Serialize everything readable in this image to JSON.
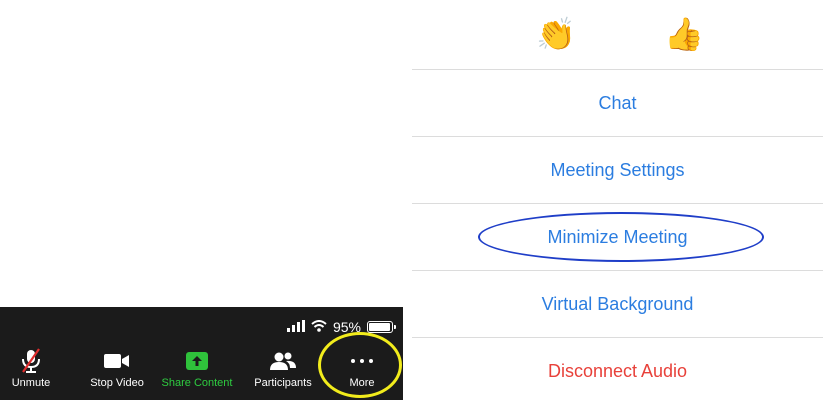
{
  "status_bar": {
    "battery_percent": "95%",
    "battery_level": 0.95
  },
  "toolbar": {
    "unmute_label": "Unmute",
    "stop_video_label": "Stop Video",
    "share_label": "Share Content",
    "participants_label": "Participants",
    "more_label": "More"
  },
  "menu": {
    "items": [
      {
        "label": "Chat"
      },
      {
        "label": "Meeting Settings"
      },
      {
        "label": "Minimize Meeting"
      },
      {
        "label": "Virtual Background"
      },
      {
        "label": "Disconnect Audio"
      }
    ]
  },
  "colors": {
    "toolbar_bg": "#1b1b1b",
    "share_green": "#2fc23b",
    "menu_blue": "#2b7de0",
    "danger_red": "#e8413a",
    "annotation_yellow": "#f2ec1c",
    "annotation_blue": "#1f3ec8"
  },
  "icons": [
    "clapping-hands-icon",
    "thumbs-up-icon",
    "microphone-muted-icon",
    "video-camera-icon",
    "share-arrow-icon",
    "participants-icon",
    "more-dots-icon",
    "signal-icon",
    "wifi-icon",
    "battery-icon"
  ]
}
